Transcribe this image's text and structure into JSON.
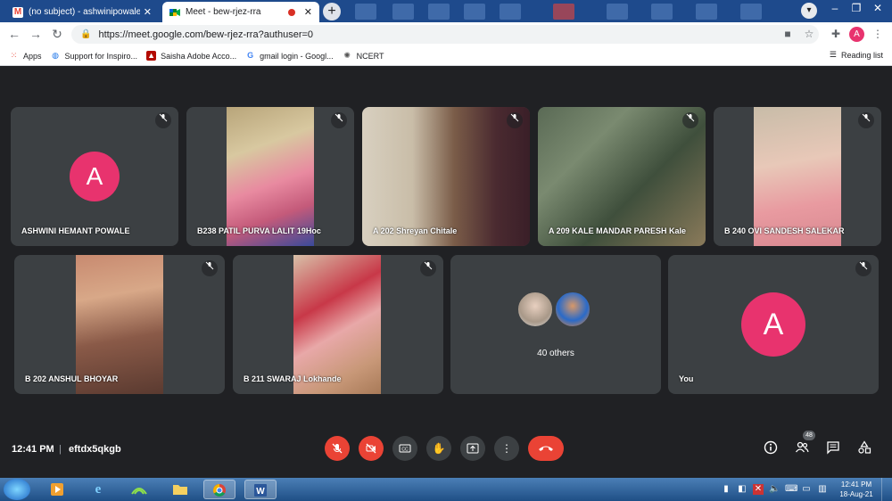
{
  "browser": {
    "tabs": [
      {
        "title": "(no subject) - ashwinipowale@m",
        "icon": "gmail-icon"
      },
      {
        "title": "Meet - bew-rjez-rra",
        "icon": "meet-icon"
      }
    ],
    "new_tab": "+",
    "url": "https://meet.google.com/bew-rjez-rra?authuser=0",
    "profile_initial": "A",
    "bookmarks": [
      {
        "label": "Apps",
        "icon": "apps-grid-icon"
      },
      {
        "label": "Support for Inspiro...",
        "icon": "globe-icon"
      },
      {
        "label": "Saisha Adobe Acco...",
        "icon": "adobe-icon"
      },
      {
        "label": "gmail login - Googl...",
        "icon": "google-icon"
      },
      {
        "label": "NCERT",
        "icon": "ncert-icon"
      }
    ],
    "reading_list": "Reading list"
  },
  "meeting": {
    "participants_row1": [
      {
        "name": "ASHWINI HEMANT POWALE",
        "kind": "avatar",
        "initial": "A"
      },
      {
        "name": "B238 PATIL PURVA LALIT 19Hoc",
        "kind": "video"
      },
      {
        "name": "A 202 Shreyan Chitale",
        "kind": "video"
      },
      {
        "name": "A 209 KALE MANDAR PARESH Kale",
        "kind": "video"
      },
      {
        "name": "B 240 OVI SANDESH SALEKAR",
        "kind": "video"
      }
    ],
    "participants_row2": [
      {
        "name": "B 202 ANSHUL BHOYAR",
        "kind": "video"
      },
      {
        "name": "B 211 SWARAJ Lokhande",
        "kind": "video"
      },
      {
        "name": "40 others",
        "kind": "others"
      },
      {
        "name": "You",
        "kind": "avatar",
        "initial": "A"
      }
    ]
  },
  "controls": {
    "time": "12:41 PM",
    "separator": "|",
    "meeting_code": "eftdx5qkgb",
    "people_count": "48"
  },
  "taskbar": {
    "time": "12:41 PM",
    "date": "18-Aug-21"
  }
}
